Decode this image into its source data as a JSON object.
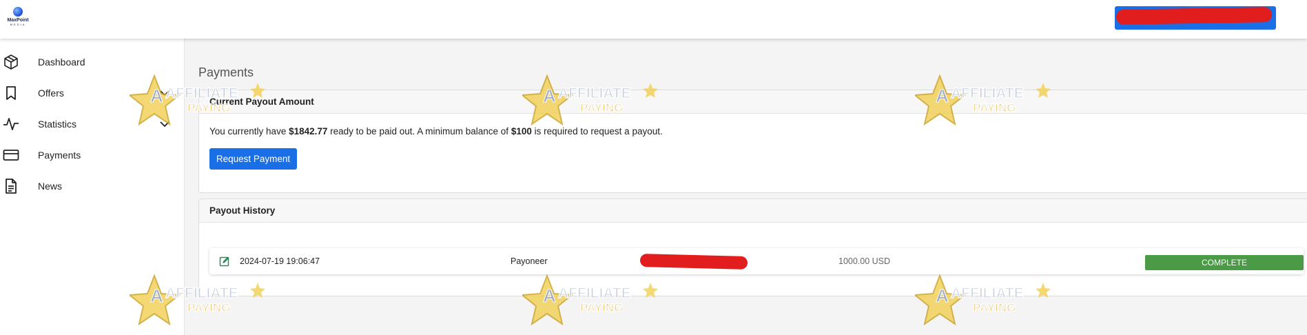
{
  "header": {
    "logo": {
      "name": "MaxPoint",
      "tagline": "MEDIA"
    },
    "user_button": {
      "label": ""
    }
  },
  "sidebar": {
    "items": [
      {
        "label": "Dashboard",
        "icon": "cube-icon"
      },
      {
        "label": "Offers",
        "icon": "bookmark-icon",
        "expandable": true
      },
      {
        "label": "Statistics",
        "icon": "activity-icon",
        "expandable": true
      },
      {
        "label": "Payments",
        "icon": "credit-card-icon"
      },
      {
        "label": "News",
        "icon": "document-icon"
      }
    ]
  },
  "page": {
    "title": "Payments"
  },
  "current_payout": {
    "heading": "Current Payout Amount",
    "text_before": "You currently have ",
    "amount": "$1842.77",
    "text_middle": " ready to be paid out. A minimum balance of ",
    "minimum": "$100",
    "text_after": " is required to request a payout.",
    "button_label": "Request Payment"
  },
  "payout_history": {
    "heading": "Payout History",
    "rows": [
      {
        "date": "2024-07-19 19:06:47",
        "method": "Payoneer",
        "account": "",
        "amount": "1000.00 USD",
        "status": "COMPLETE"
      }
    ]
  },
  "watermark": {
    "line1": "AFFILIATE",
    "line2": "PAYING"
  },
  "colors": {
    "primary": "#1a6fe6",
    "status_complete": "#4a9a46",
    "redaction": "#e11d1d"
  }
}
